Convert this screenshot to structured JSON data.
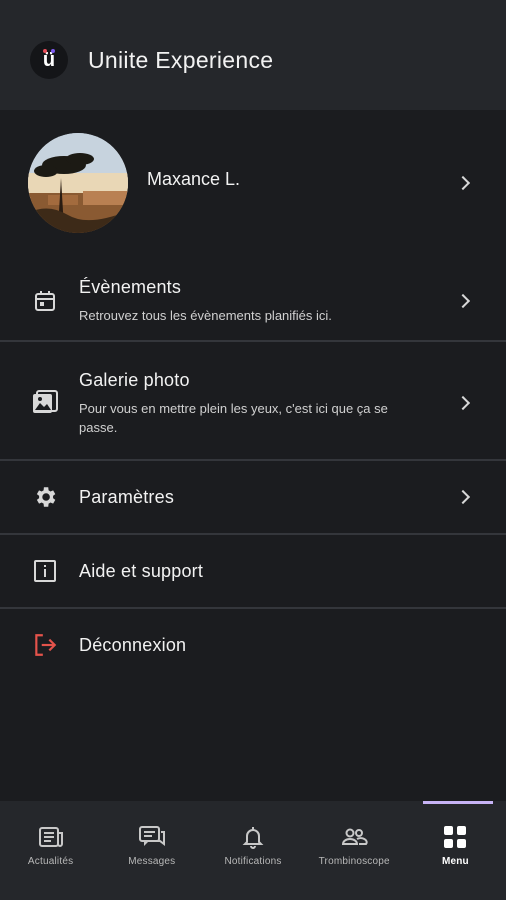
{
  "header": {
    "logo_letter": "ü",
    "title": "Uniite Experience"
  },
  "profile": {
    "name": "Maxance L."
  },
  "menu": {
    "events": {
      "label": "Évènements",
      "description": "Retrouvez tous les évènements planifiés ici.",
      "icon": "calendar-icon"
    },
    "gallery": {
      "label": "Galerie photo",
      "description": "Pour vous en mettre plein les yeux, c'est ici que ça se passe.",
      "icon": "photo-gallery-icon"
    },
    "settings": {
      "label": "Paramètres",
      "icon": "gear-icon"
    },
    "help": {
      "label": "Aide et support",
      "icon": "info-icon"
    },
    "logout": {
      "label": "Déconnexion",
      "icon": "logout-icon",
      "color": "#e5534b"
    }
  },
  "bottom_nav": {
    "items": [
      {
        "label": "Actualités",
        "icon": "newspaper-icon"
      },
      {
        "label": "Messages",
        "icon": "chat-icon"
      },
      {
        "label": "Notifications",
        "icon": "bell-icon"
      },
      {
        "label": "Trombinoscope",
        "icon": "people-icon"
      },
      {
        "label": "Menu",
        "icon": "grid-icon",
        "active": true
      }
    ],
    "active_color": "#c7b3f5"
  }
}
